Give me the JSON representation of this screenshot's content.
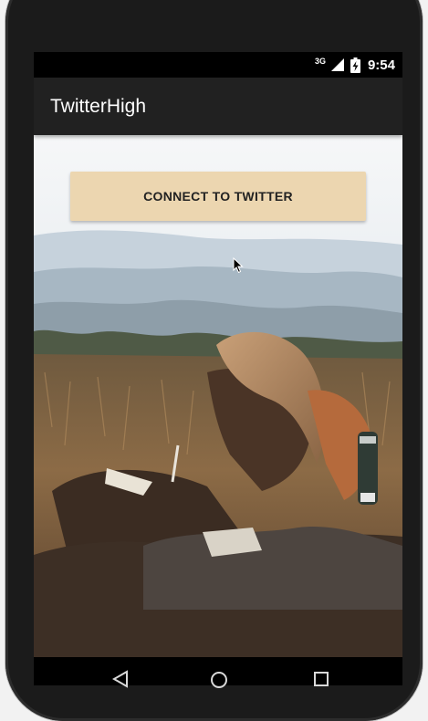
{
  "status_bar": {
    "network_type": "3G",
    "time": "9:54",
    "icons": [
      "signal-icon",
      "battery-charging-icon"
    ]
  },
  "app_bar": {
    "title": "TwitterHigh",
    "background": "#212121"
  },
  "main": {
    "connect_button_label": "CONNECT TO TWITTER",
    "connect_button_color": "#ECD6B0",
    "background_image": "woman-writing-in-field-photo"
  },
  "nav_bar": {
    "icons": [
      "back-icon",
      "home-icon",
      "recents-icon"
    ]
  }
}
